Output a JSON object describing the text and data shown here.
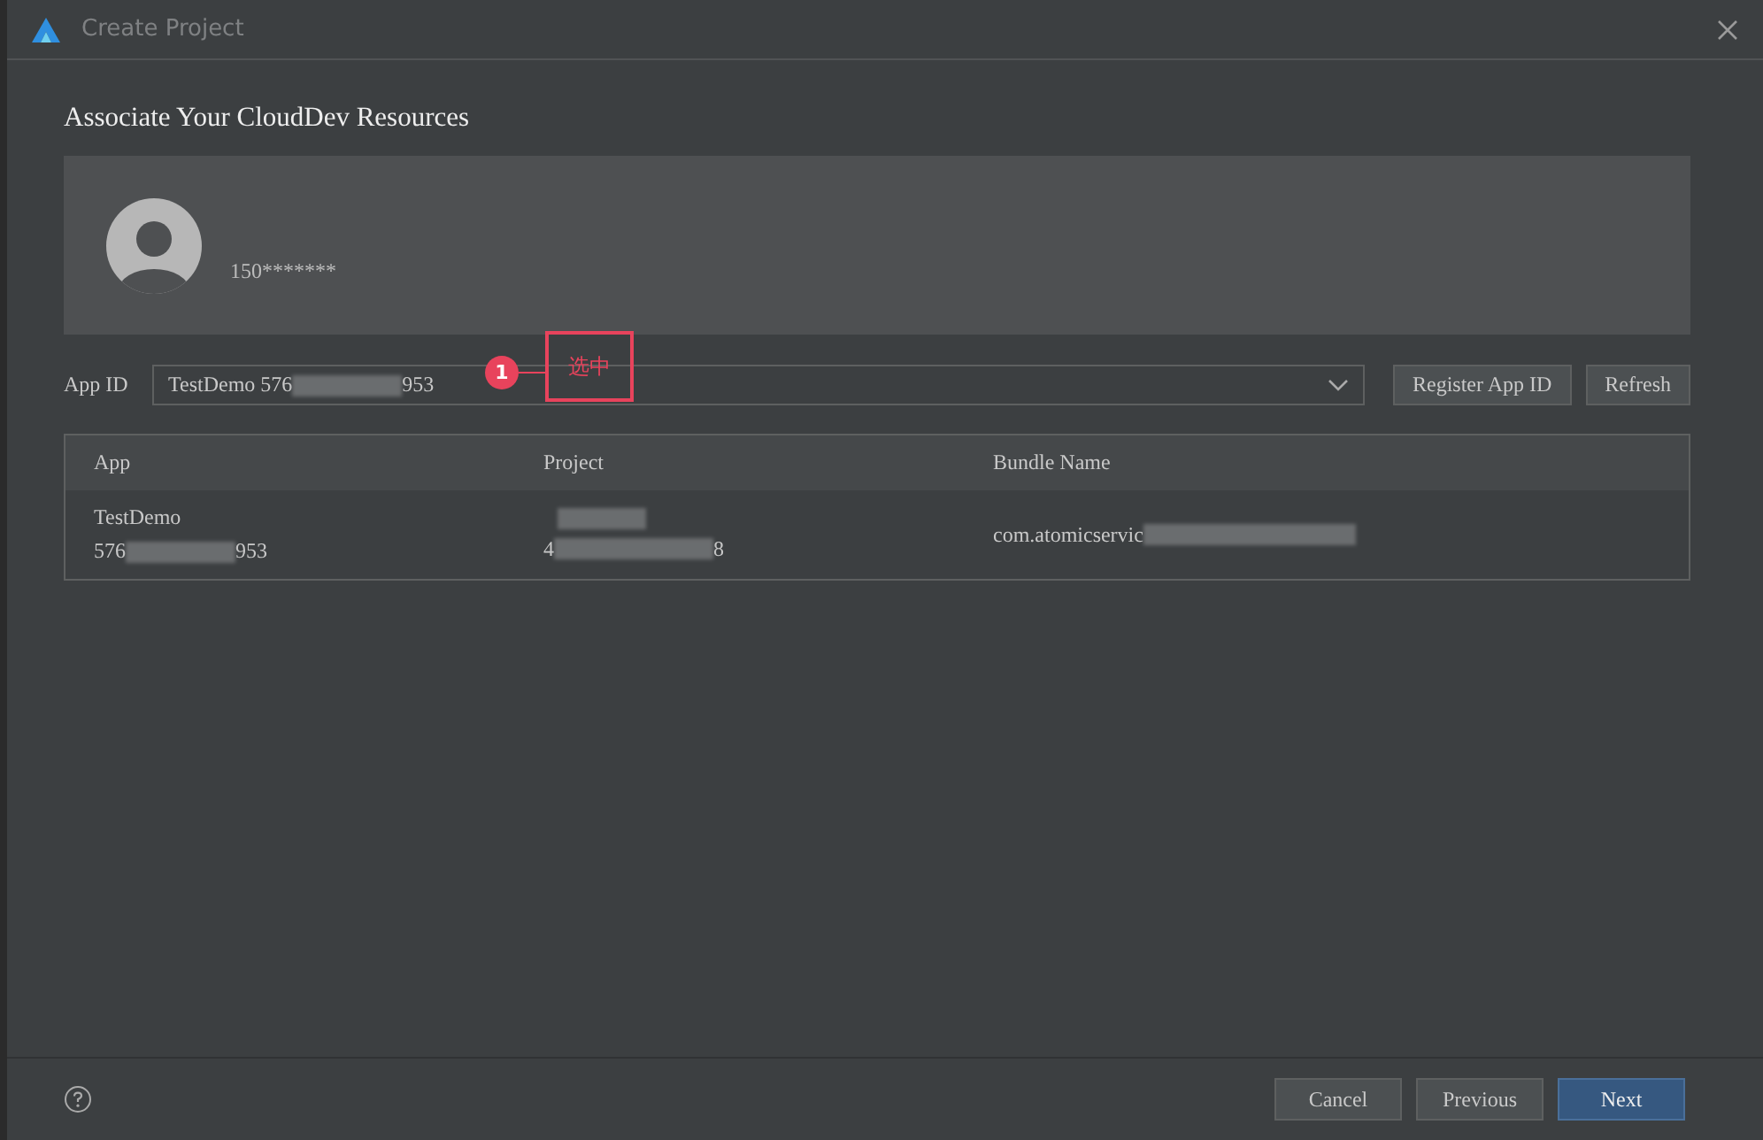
{
  "window": {
    "title": "Create Project"
  },
  "heading": "Associate Your CloudDev Resources",
  "account": {
    "name": "150*******"
  },
  "app_id": {
    "label": "App ID",
    "value_start": "TestDemo 576",
    "value_end": "953"
  },
  "annotation": {
    "number": "1",
    "text": "选中"
  },
  "actions": [
    "Register App ID",
    "Refresh"
  ],
  "table": {
    "columns": [
      "App",
      "Project",
      "Bundle Name"
    ],
    "rows": [
      {
        "app": {
          "name": "TestDemo",
          "id_start": "576",
          "id_end": "953"
        },
        "project": {
          "id_start": "4",
          "id_end": "8"
        },
        "bundle": {
          "start": "com.atomicservic"
        }
      }
    ]
  },
  "footer": {
    "buttons": [
      {
        "label": "Cancel",
        "primary": false
      },
      {
        "label": "Previous",
        "primary": false
      },
      {
        "label": "Next",
        "primary": true
      }
    ]
  }
}
